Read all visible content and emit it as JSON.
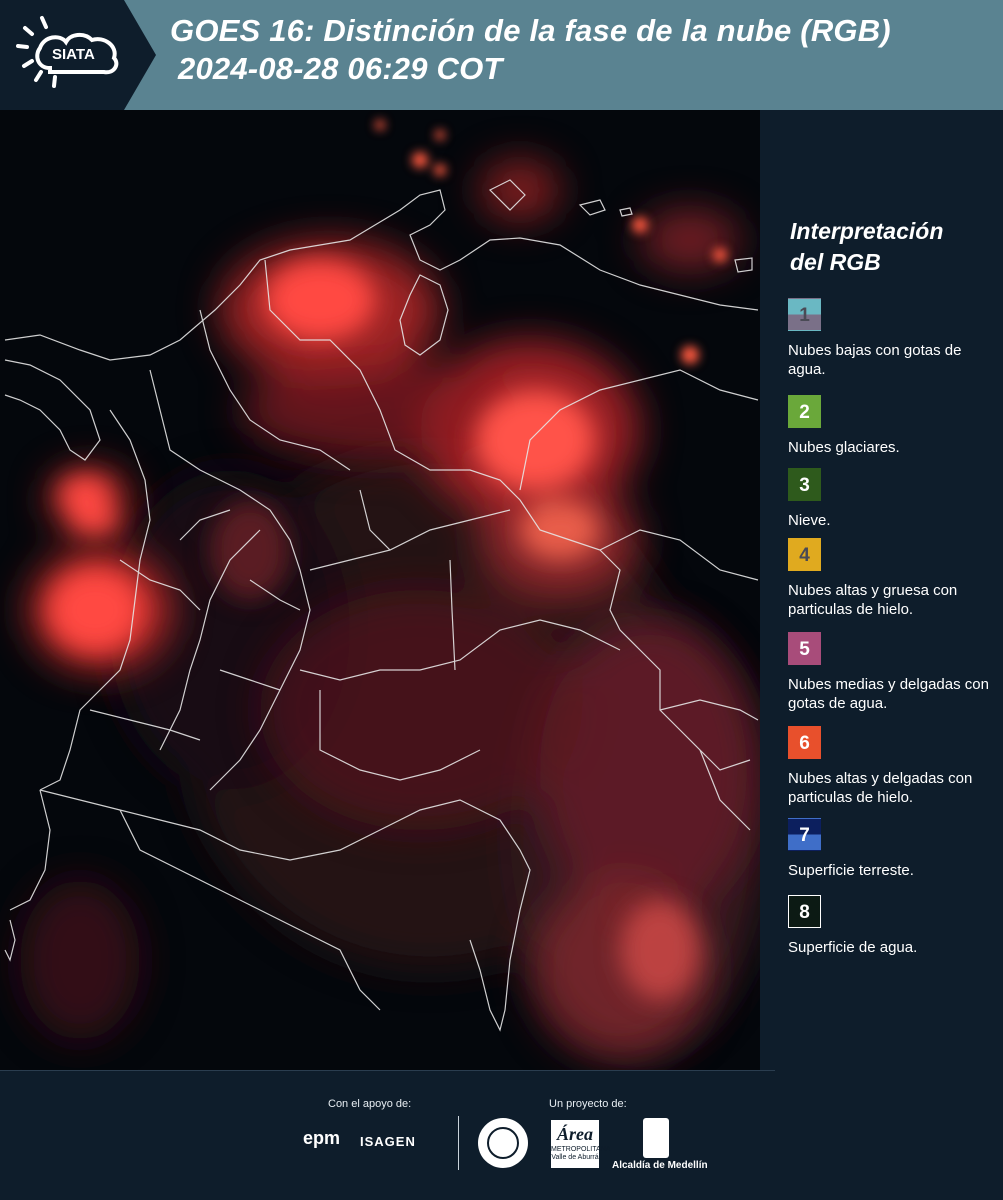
{
  "header": {
    "logo_text": "SIATA",
    "title": "GOES 16: Distinción de la fase de la nube (RGB)",
    "datetime": "2024-08-28 06:29 COT"
  },
  "legend": {
    "title_line1": "Interpretación",
    "title_line2": "del RGB",
    "items": [
      {
        "number": "1",
        "label": "Nubes bajas con gotas de agua.",
        "color_top": "#6ab8c3",
        "color_bottom": "#7a7088",
        "number_color": "#4a4a55"
      },
      {
        "number": "2",
        "label": "Nubes glaciares.",
        "color_top": "#6aa83a",
        "color_bottom": "#6aa83a",
        "number_color": "#ffffff"
      },
      {
        "number": "3",
        "label": "Nieve.",
        "color_top": "#2e5a1c",
        "color_bottom": "#2e5a1c",
        "number_color": "#ffffff"
      },
      {
        "number": "4",
        "label": "Nubes altas y gruesa con particulas de hielo.",
        "color_top": "#e0aa1f",
        "color_bottom": "#e0aa1f",
        "number_color": "#4a4a55"
      },
      {
        "number": "5",
        "label": "Nubes medias y delgadas con gotas de agua.",
        "color_top": "#a84c7a",
        "color_bottom": "#a84c7a",
        "number_color": "#ffffff"
      },
      {
        "number": "6",
        "label": "Nubes altas y delgadas con particulas de hielo.",
        "color_top": "#e8502c",
        "color_bottom": "#e8502c",
        "number_color": "#ffffff"
      },
      {
        "number": "7",
        "label": "Superficie terreste.",
        "color_top": "#0c1f5e",
        "color_bottom": "#3f6ec8",
        "number_color": "#ffffff"
      },
      {
        "number": "8",
        "label": "Superficie de agua.",
        "color_top": "#0c1a14",
        "color_bottom": "#0c1a14",
        "number_color": "#ffffff"
      }
    ]
  },
  "footer": {
    "support_text": "Con el apoyo de:",
    "project_text": "Un proyecto de:",
    "sponsor1": "epm",
    "sponsor2": "ISAGEN",
    "area_logo_script": "Área",
    "area_logo_text": "METROPOLITANA Valle de Aburrá",
    "alcaldia": "Alcaldía de Medellín"
  }
}
